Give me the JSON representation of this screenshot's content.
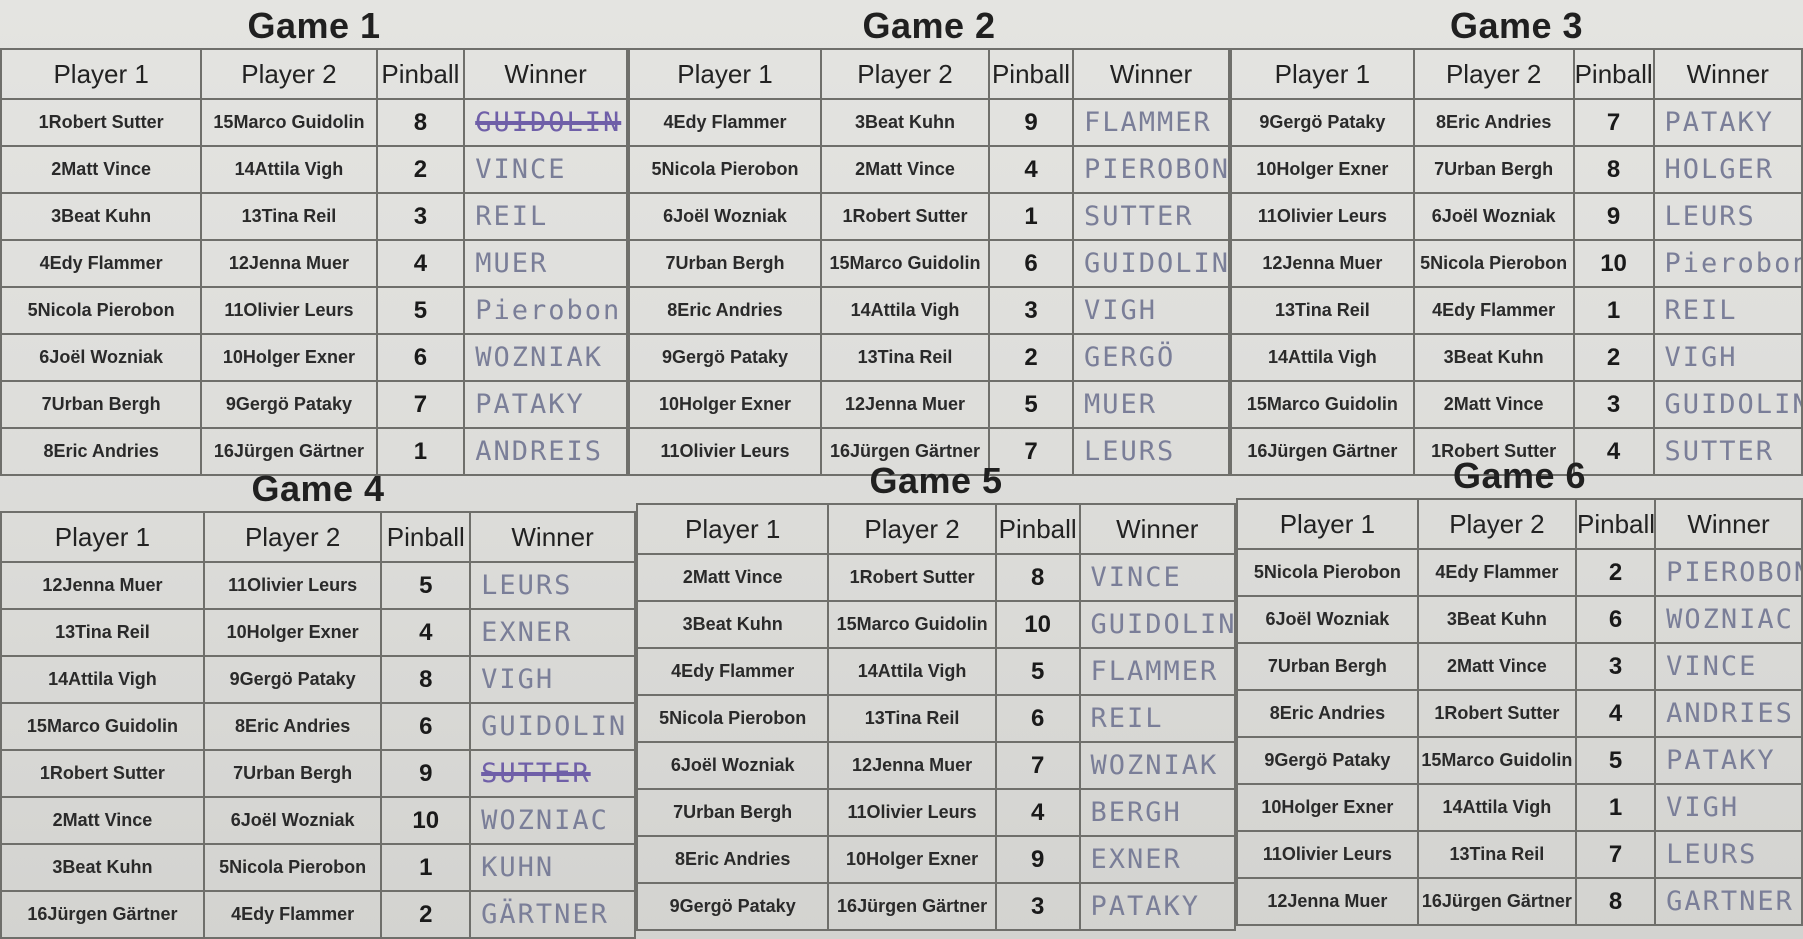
{
  "headers": {
    "player1": "Player 1",
    "player2": "Player 2",
    "pinball": "Pinball",
    "winner": "Winner"
  },
  "games": [
    {
      "title": "Game 1",
      "rows": [
        [
          "1Robert Sutter",
          "15Marco Guidolin",
          "8",
          "GUIDOLIN"
        ],
        [
          "2Matt Vince",
          "14Attila Vigh",
          "2",
          "VINCE"
        ],
        [
          "3Beat Kuhn",
          "13Tina Reil",
          "3",
          "REIL"
        ],
        [
          "4Edy Flammer",
          "12Jenna Muer",
          "4",
          "MUER"
        ],
        [
          "5Nicola Pierobon",
          "11Olivier Leurs",
          "5",
          "Pierobon"
        ],
        [
          "6Joël Wozniak",
          "10Holger Exner",
          "6",
          "WOZNIAK"
        ],
        [
          "7Urban Bergh",
          "9Gergö Pataky",
          "7",
          "PATAKY"
        ],
        [
          "8Eric Andries",
          "16Jürgen Gärtner",
          "1",
          "ANDREIS"
        ]
      ]
    },
    {
      "title": "Game 2",
      "rows": [
        [
          "4Edy Flammer",
          "3Beat Kuhn",
          "9",
          "FLAMMER"
        ],
        [
          "5Nicola Pierobon",
          "2Matt Vince",
          "4",
          "PIEROBON"
        ],
        [
          "6Joël Wozniak",
          "1Robert Sutter",
          "1",
          "SUTTER"
        ],
        [
          "7Urban Bergh",
          "15Marco Guidolin",
          "6",
          "GUIDOLIN"
        ],
        [
          "8Eric Andries",
          "14Attila Vigh",
          "3",
          "VIGH"
        ],
        [
          "9Gergö Pataky",
          "13Tina Reil",
          "2",
          "GERGÖ"
        ],
        [
          "10Holger Exner",
          "12Jenna Muer",
          "5",
          "MUER"
        ],
        [
          "11Olivier Leurs",
          "16Jürgen Gärtner",
          "7",
          "LEURS"
        ]
      ]
    },
    {
      "title": "Game 3",
      "rows": [
        [
          "9Gergö Pataky",
          "8Eric Andries",
          "7",
          "PATAKY"
        ],
        [
          "10Holger Exner",
          "7Urban Bergh",
          "8",
          "HOLGER"
        ],
        [
          "11Olivier Leurs",
          "6Joël Wozniak",
          "9",
          "LEURS"
        ],
        [
          "12Jenna Muer",
          "5Nicola Pierobon",
          "10",
          "Pierobon"
        ],
        [
          "13Tina Reil",
          "4Edy Flammer",
          "1",
          "REIL"
        ],
        [
          "14Attila Vigh",
          "3Beat Kuhn",
          "2",
          "VIGH"
        ],
        [
          "15Marco Guidolin",
          "2Matt Vince",
          "3",
          "GUIDOLIN"
        ],
        [
          "16Jürgen Gärtner",
          "1Robert Sutter",
          "4",
          "SUTTER"
        ]
      ]
    },
    {
      "title": "Game 4",
      "rows": [
        [
          "12Jenna Muer",
          "11Olivier Leurs",
          "5",
          "LEURS"
        ],
        [
          "13Tina Reil",
          "10Holger Exner",
          "4",
          "EXNER"
        ],
        [
          "14Attila Vigh",
          "9Gergö Pataky",
          "8",
          "VIGH"
        ],
        [
          "15Marco Guidolin",
          "8Eric Andries",
          "6",
          "GUIDOLIN"
        ],
        [
          "1Robert Sutter",
          "7Urban Bergh",
          "9",
          "SUTTER"
        ],
        [
          "2Matt Vince",
          "6Joël Wozniak",
          "10",
          "WOZNIAC"
        ],
        [
          "3Beat Kuhn",
          "5Nicola Pierobon",
          "1",
          "KUHN"
        ],
        [
          "16Jürgen Gärtner",
          "4Edy Flammer",
          "2",
          "GÄRTNER"
        ]
      ]
    },
    {
      "title": "Game 5",
      "rows": [
        [
          "2Matt Vince",
          "1Robert Sutter",
          "8",
          "VINCE"
        ],
        [
          "3Beat Kuhn",
          "15Marco Guidolin",
          "10",
          "GUIDOLIN"
        ],
        [
          "4Edy Flammer",
          "14Attila Vigh",
          "5",
          "FLAMMER"
        ],
        [
          "5Nicola Pierobon",
          "13Tina Reil",
          "6",
          "REIL"
        ],
        [
          "6Joël Wozniak",
          "12Jenna Muer",
          "7",
          "WOZNIAK"
        ],
        [
          "7Urban Bergh",
          "11Olivier Leurs",
          "4",
          "BERGH"
        ],
        [
          "8Eric Andries",
          "10Holger Exner",
          "9",
          "EXNER"
        ],
        [
          "9Gergö Pataky",
          "16Jürgen Gärtner",
          "3",
          "PATAKY"
        ]
      ]
    },
    {
      "title": "Game 6",
      "rows": [
        [
          "5Nicola Pierobon",
          "4Edy Flammer",
          "2",
          "PIEROBON"
        ],
        [
          "6Joël Wozniak",
          "3Beat Kuhn",
          "6",
          "WOZNIAC"
        ],
        [
          "7Urban Bergh",
          "2Matt Vince",
          "3",
          "VINCE"
        ],
        [
          "8Eric Andries",
          "1Robert Sutter",
          "4",
          "ANDRIES"
        ],
        [
          "9Gergö Pataky",
          "15Marco Guidolin",
          "5",
          "PATAKY"
        ],
        [
          "10Holger Exner",
          "14Attila Vigh",
          "1",
          "VIGH"
        ],
        [
          "11Olivier Leurs",
          "13Tina Reil",
          "7",
          "LEURS"
        ],
        [
          "12Jenna Muer",
          "16Jürgen Gärtner",
          "8",
          "GARTNER"
        ]
      ]
    }
  ]
}
